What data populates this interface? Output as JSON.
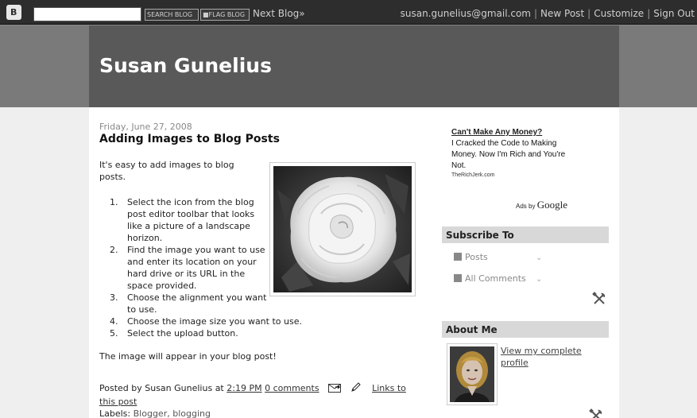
{
  "navbar": {
    "logo_letter": "B",
    "search_value": "",
    "search_blog_label": "SEARCH BLOG",
    "flag_blog_label": "■FLAG BLOG",
    "next_blog_label": "Next Blog»",
    "user_email": "susan.gunelius@gmail.com",
    "new_post_label": "New Post",
    "customize_label": "Customize",
    "sign_out_label": "Sign Out",
    "separator": "|"
  },
  "header": {
    "blog_title": "Susan Gunelius"
  },
  "post": {
    "date": "Friday, June 27, 2008",
    "title": "Adding Images to Blog Posts",
    "intro": "It's easy to add images to blog posts.",
    "steps": [
      {
        "num": "1.",
        "text": "Select the icon from the blog post editor toolbar that looks like a picture of a landscape horizon."
      },
      {
        "num": "2.",
        "text": "Find the image you want to use and enter its location on your hard drive or its URL in the space provided."
      },
      {
        "num": "3.",
        "text": "Choose the alignment you want to use."
      },
      {
        "num": "4.",
        "text": "Choose the image size you want to use."
      },
      {
        "num": "5.",
        "text": "Select the upload button."
      }
    ],
    "closing": "The image will appear in your blog post!",
    "footer": {
      "posted_by": "Posted by Susan Gunelius at",
      "time": "2:19 PM",
      "comments": "0 comments",
      "links_to": "Links to this post"
    },
    "labels": {
      "prefix": "Labels:",
      "values": "Blogger, blogging"
    }
  },
  "sidebar": {
    "ad": {
      "headline": "Can't Make Any Money?",
      "body": "I Cracked the Code to Making Money. Now I'm Rich and You're Not.",
      "url": "TheRichJerk.com",
      "ads_by": "Ads by",
      "google": "Google"
    },
    "subscribe": {
      "title": "Subscribe To",
      "posts_label": "Posts",
      "comments_label": "All Comments"
    },
    "about": {
      "title": "About Me",
      "profile_link": "View my complete profile"
    }
  },
  "icons": [
    "blogger-logo-icon",
    "email-post-icon",
    "pencil-edit-icon",
    "feed-icon",
    "chevron-down-icon",
    "wrench-screwdriver-icon"
  ]
}
